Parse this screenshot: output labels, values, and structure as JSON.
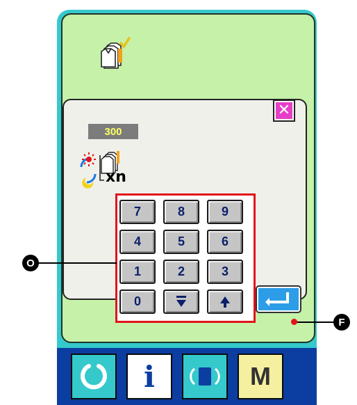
{
  "dialog": {
    "count_value": "300",
    "multiplier_label": "xn"
  },
  "keypad": {
    "keys": [
      "7",
      "8",
      "9",
      "4",
      "5",
      "6",
      "1",
      "2",
      "3",
      "0",
      "▼",
      "▲"
    ]
  },
  "annotations": {
    "keypad_marker": "O",
    "enter_marker": "F"
  },
  "bottom_bar": {
    "info_label": "i",
    "mode_label": "M"
  },
  "colors": {
    "device": "#35c9cc",
    "screen": "#c5f1a9",
    "close": "#e63ec8",
    "enter": "#2d9de8",
    "highlight": "#e2121a",
    "bottom_bar": "#0b3ea0"
  }
}
